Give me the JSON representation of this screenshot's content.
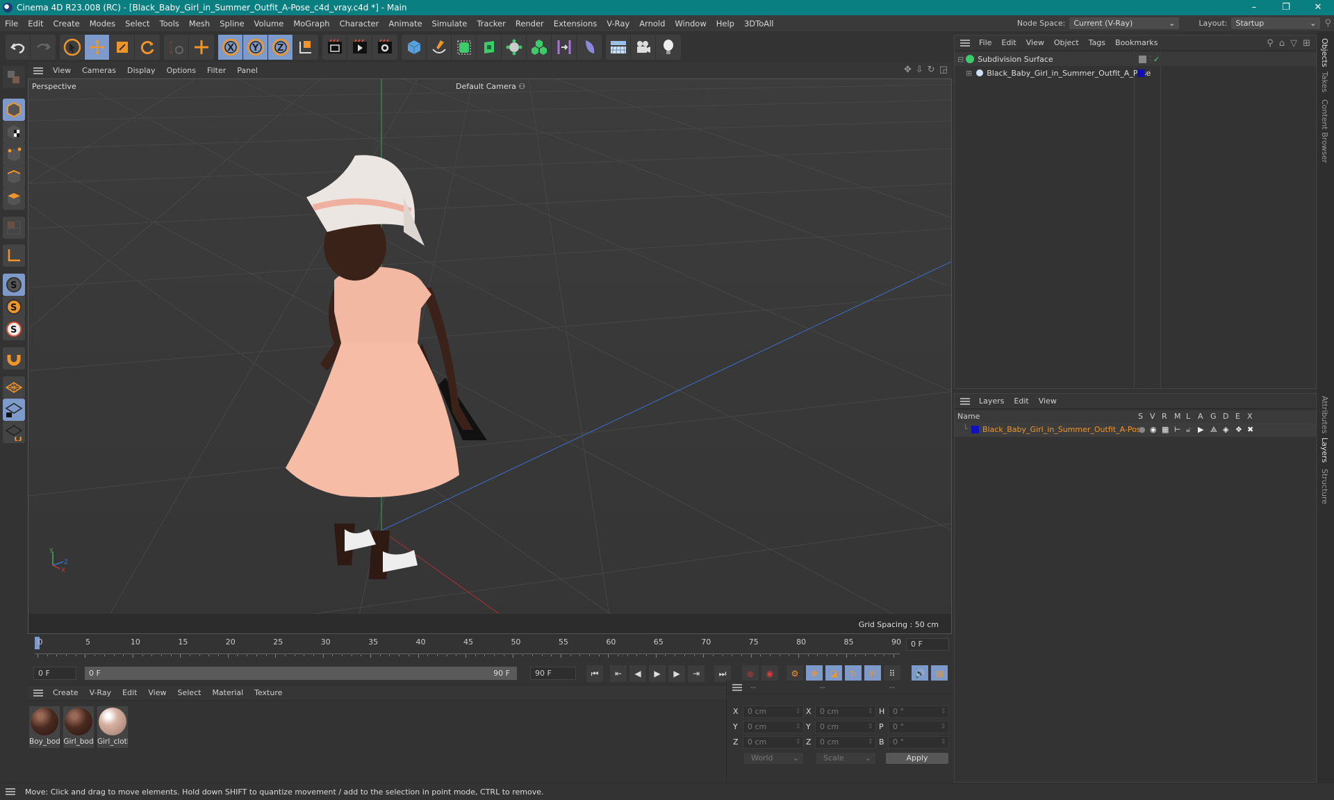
{
  "window": {
    "title": "Cinema 4D R23.008 (RC) - [Black_Baby_Girl_in_Summer_Outfit_A-Pose_c4d_vray.c4d *] - Main",
    "controls": [
      "minimize",
      "restore",
      "close"
    ]
  },
  "menubar": {
    "items": [
      "File",
      "Edit",
      "Create",
      "Modes",
      "Select",
      "Tools",
      "Mesh",
      "Spline",
      "Volume",
      "MoGraph",
      "Character",
      "Animate",
      "Simulate",
      "Tracker",
      "Render",
      "Extensions",
      "V-Ray",
      "Arnold",
      "Window",
      "Help",
      "3DToAll"
    ],
    "node_space_label": "Node Space:",
    "node_space_value": "Current (V-Ray)",
    "layout_label": "Layout:",
    "layout_value": "Startup"
  },
  "toolbar": {
    "groups": [
      [
        "undo-icon",
        "redo-icon"
      ],
      [
        "select-icon",
        "move-icon",
        "scale-icon",
        "rotate-icon"
      ],
      [
        "psr-icon",
        "add-icon"
      ],
      [
        "x-axis-icon",
        "y-axis-icon",
        "z-axis-icon",
        "world-coord-icon"
      ],
      [
        "render-view-icon",
        "render-picture-viewer-icon",
        "render-settings-icon"
      ],
      [
        "cube-icon",
        "pen-icon",
        "subdivision-icon",
        "extrude-icon",
        "cloner-icon",
        "mograph-icon",
        "symmetry-icon",
        "deformer-icon"
      ],
      [
        "floor-icon",
        "camera-icon",
        "light-icon"
      ]
    ]
  },
  "left_tools": [
    "make-editable-icon",
    "model-mode-icon",
    "texture-mode-icon",
    "point-mode-icon",
    "edge-mode-icon",
    "polygon-mode-icon",
    "uv-mode-icon",
    "axis-mode-icon",
    "snap-icon",
    "snap-settings-icon",
    "snap-enable-icon",
    "magnet-icon",
    "workplane-icon",
    "locked-workplane-icon",
    "align-workplane-icon"
  ],
  "viewport": {
    "menu": [
      "View",
      "Cameras",
      "Display",
      "Options",
      "Filter",
      "Panel"
    ],
    "view_name": "Perspective",
    "camera": "Default Camera",
    "grid_spacing": "Grid Spacing : 50 cm",
    "axis_labels": {
      "x": "X",
      "y": "Y",
      "z": "Z"
    }
  },
  "timeline": {
    "ticks": [
      "0",
      "5",
      "10",
      "15",
      "20",
      "25",
      "30",
      "35",
      "40",
      "45",
      "50",
      "55",
      "60",
      "65",
      "70",
      "75",
      "80",
      "85",
      "90"
    ],
    "current_frame": "0 F",
    "start_field": "0 F",
    "range_start": "0 F",
    "range_end": "90 F",
    "end_field": "90 F"
  },
  "material_manager": {
    "menu": [
      "Create",
      "V-Ray",
      "Edit",
      "View",
      "Select",
      "Material",
      "Texture"
    ],
    "materials": [
      {
        "name": "Boy_bod",
        "color": "#4a2a20"
      },
      {
        "name": "Girl_bod",
        "color": "#4a2a20"
      },
      {
        "name": "Girl_clotl",
        "color": "#d8b0a0"
      }
    ]
  },
  "coordinates": {
    "headers": [
      "--",
      "--",
      "--"
    ],
    "rows": [
      {
        "a": "X",
        "av": "0 cm",
        "b": "X",
        "bv": "0 cm",
        "c": "H",
        "cv": "0 °"
      },
      {
        "a": "Y",
        "av": "0 cm",
        "b": "Y",
        "bv": "0 cm",
        "c": "P",
        "cv": "0 °"
      },
      {
        "a": "Z",
        "av": "0 cm",
        "b": "Z",
        "bv": "0 cm",
        "c": "B",
        "cv": "0 °"
      }
    ],
    "space": "World",
    "mode": "Scale",
    "apply": "Apply"
  },
  "object_manager": {
    "menu": [
      "File",
      "Edit",
      "View",
      "Object",
      "Tags",
      "Bookmarks"
    ],
    "objects": [
      {
        "name": "Subdivision Surface",
        "level": 0
      },
      {
        "name": "Black_Baby_Girl_in_Summer_Outfit_A_Pose",
        "level": 1
      }
    ]
  },
  "layer_manager": {
    "menu": [
      "Layers",
      "Edit",
      "View"
    ],
    "columns": [
      "Name",
      "S",
      "V",
      "R",
      "M",
      "L",
      "A",
      "G",
      "D",
      "E",
      "X"
    ],
    "layers": [
      {
        "name": "Black_Baby_Girl_in_Summer_Outfit_A-Pose",
        "color": "#1010c0"
      }
    ]
  },
  "right_tabs": {
    "top": [
      "Objects",
      "Takes",
      "Content Browser"
    ],
    "bottom": [
      "Attributes",
      "Layers",
      "Structure"
    ]
  },
  "status": "Move: Click and drag to move elements. Hold down SHIFT to quantize movement / add to the selection in point mode, CTRL to remove.",
  "colors": {
    "titlebar": "#0a7f82",
    "accent_active": "#7d9acb",
    "tool_orange": "#f0952a",
    "layer_name": "#f0952a"
  }
}
